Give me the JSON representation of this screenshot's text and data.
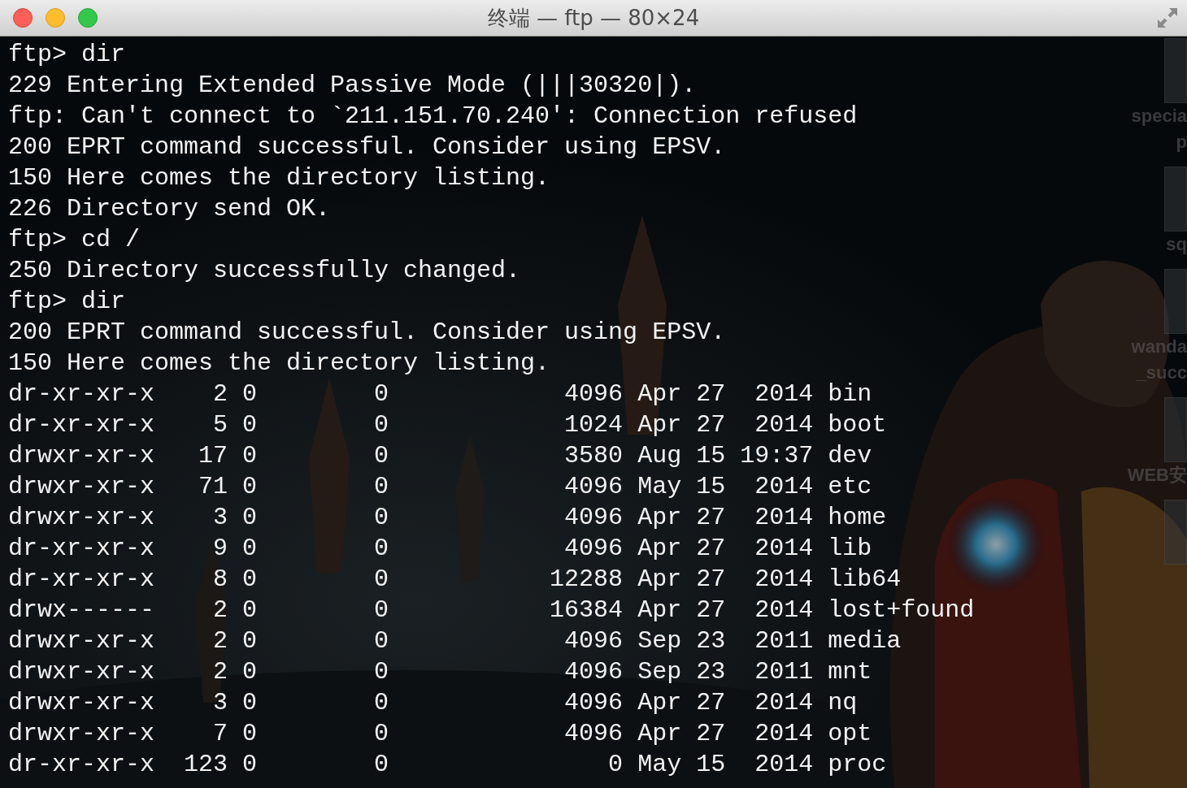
{
  "window": {
    "title": "终端 — ftp — 80×24"
  },
  "desktop_icons": [
    {
      "labels": [
        "specia",
        "p"
      ]
    },
    {
      "labels": [
        "sq"
      ]
    },
    {
      "labels": [
        "wanda",
        "_succ"
      ]
    },
    {
      "labels": [
        "WEB安"
      ]
    }
  ],
  "terminal": {
    "lines": [
      "ftp> dir",
      "229 Entering Extended Passive Mode (|||30320|).",
      "ftp: Can't connect to `211.151.70.240': Connection refused",
      "200 EPRT command successful. Consider using EPSV.",
      "150 Here comes the directory listing.",
      "226 Directory send OK.",
      "ftp> cd /",
      "250 Directory successfully changed.",
      "ftp> dir",
      "200 EPRT command successful. Consider using EPSV.",
      "150 Here comes the directory listing.",
      "dr-xr-xr-x    2 0        0            4096 Apr 27  2014 bin",
      "dr-xr-xr-x    5 0        0            1024 Apr 27  2014 boot",
      "drwxr-xr-x   17 0        0            3580 Aug 15 19:37 dev",
      "drwxr-xr-x   71 0        0            4096 May 15  2014 etc",
      "drwxr-xr-x    3 0        0            4096 Apr 27  2014 home",
      "dr-xr-xr-x    9 0        0            4096 Apr 27  2014 lib",
      "dr-xr-xr-x    8 0        0           12288 Apr 27  2014 lib64",
      "drwx------    2 0        0           16384 Apr 27  2014 lost+found",
      "drwxr-xr-x    2 0        0            4096 Sep 23  2011 media",
      "drwxr-xr-x    2 0        0            4096 Sep 23  2011 mnt",
      "drwxr-xr-x    3 0        0            4096 Apr 27  2014 nq",
      "drwxr-xr-x    7 0        0            4096 Apr 27  2014 opt",
      "dr-xr-xr-x  123 0        0               0 May 15  2014 proc"
    ]
  }
}
